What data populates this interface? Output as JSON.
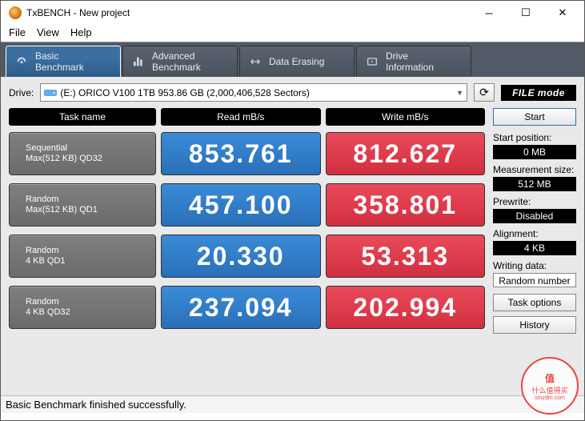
{
  "window": {
    "title": "TxBENCH - New project"
  },
  "menu": {
    "file": "File",
    "view": "View",
    "help": "Help"
  },
  "tabs": {
    "basic": "Basic\nBenchmark",
    "advanced": "Advanced\nBenchmark",
    "erase": "Data Erasing",
    "drive": "Drive\nInformation"
  },
  "drive": {
    "label": "Drive:",
    "selected": "(E:) ORICO V100 1TB   953.86 GB (2,000,406,528 Sectors)",
    "filemode": "FILE mode"
  },
  "headers": {
    "task": "Task name",
    "read": "Read mB/s",
    "write": "Write mB/s"
  },
  "rows": [
    {
      "name1": "Sequential",
      "name2": "Max(512 KB) QD32",
      "read": "853.761",
      "write": "812.627"
    },
    {
      "name1": "Random",
      "name2": "Max(512 KB) QD1",
      "read": "457.100",
      "write": "358.801"
    },
    {
      "name1": "Random",
      "name2": "4 KB QD1",
      "read": "20.330",
      "write": "53.313"
    },
    {
      "name1": "Random",
      "name2": "4 KB QD32",
      "read": "237.094",
      "write": "202.994"
    }
  ],
  "side": {
    "start": "Start",
    "startpos_lbl": "Start position:",
    "startpos_val": "0 MB",
    "meassize_lbl": "Measurement size:",
    "meassize_val": "512 MB",
    "prewrite_lbl": "Prewrite:",
    "prewrite_val": "Disabled",
    "align_lbl": "Alignment:",
    "align_val": "4 KB",
    "wdata_lbl": "Writing data:",
    "wdata_val": "Random number",
    "taskopt": "Task options",
    "history": "History"
  },
  "status": "Basic Benchmark finished successfully.",
  "watermark": {
    "line1": "值",
    "line2": "什么值得买",
    "line3": "smzdm.com"
  }
}
